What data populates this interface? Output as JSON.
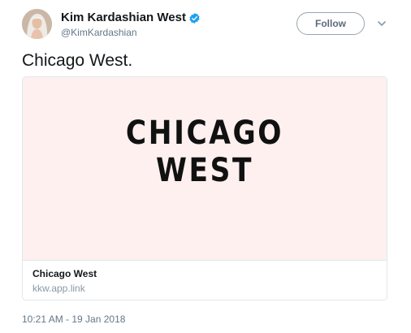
{
  "author": {
    "display_name": "Kim Kardashian West",
    "handle": "@KimKardashian",
    "verified": true,
    "verified_color": "#1da1f2"
  },
  "actions": {
    "follow_label": "Follow",
    "more_icon": "chevron-down-icon"
  },
  "tweet": {
    "text": "Chicago West.",
    "timestamp": "10:21 AM - 19 Jan 2018"
  },
  "card": {
    "image_line1": "CHICAGO",
    "image_line2": "WEST",
    "image_background": "#fdf0ef",
    "title": "Chicago West",
    "url": "kkw.app.link"
  }
}
